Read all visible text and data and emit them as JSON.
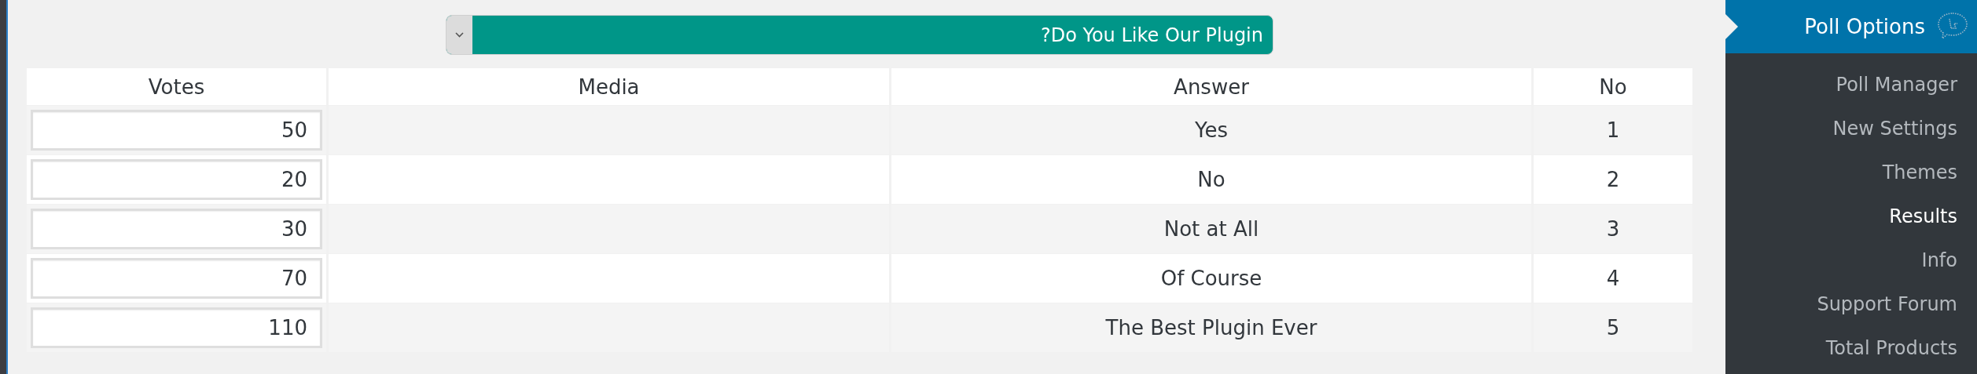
{
  "question_dropdown": {
    "value": "?Do You Like Our Plugin"
  },
  "table": {
    "columns": [
      "Votes",
      "Media",
      "Answer",
      "No"
    ],
    "rows": [
      {
        "votes": "50",
        "answer": "Yes",
        "no": "1"
      },
      {
        "votes": "20",
        "answer": "No",
        "no": "2"
      },
      {
        "votes": "30",
        "answer": "Not at All",
        "no": "3"
      },
      {
        "votes": "70",
        "answer": "Of Course",
        "no": "4"
      },
      {
        "votes": "110",
        "answer": "The Best Plugin Ever",
        "no": "5"
      }
    ]
  },
  "sidebar": {
    "title": "Poll Options",
    "items": [
      {
        "label": "Poll Manager",
        "selected": false
      },
      {
        "label": "New Settings",
        "selected": false
      },
      {
        "label": "Themes",
        "selected": false
      },
      {
        "label": "Results",
        "selected": true
      },
      {
        "label": "Info",
        "selected": false
      },
      {
        "label": "Support Forum",
        "selected": false
      },
      {
        "label": "Total Products",
        "selected": false
      }
    ]
  }
}
